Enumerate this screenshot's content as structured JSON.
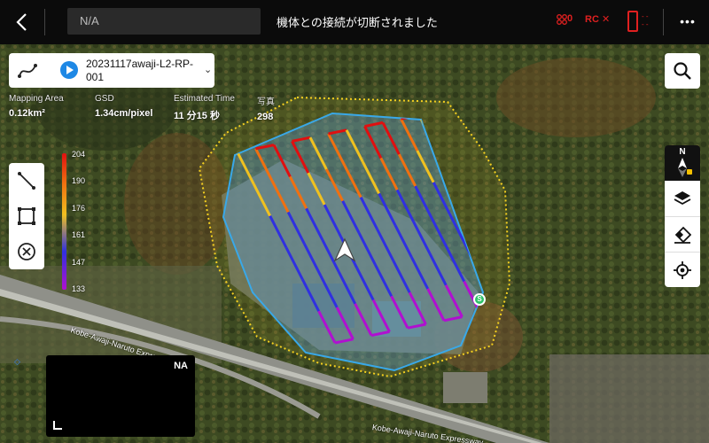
{
  "header": {
    "mission_title": "N/A",
    "connection_message": "機体との接続が切断されました",
    "drone_status": "0",
    "rc_status": "RC ✕",
    "battery_dashes": "- -\n- -",
    "more_menu": "•••"
  },
  "mission": {
    "name": "20231117awaji-L2-RP-001"
  },
  "stats": [
    {
      "label": "Mapping Area",
      "value": "0.12km²"
    },
    {
      "label": "GSD",
      "value": "1.34cm/pixel"
    },
    {
      "label": "Estimated Time",
      "value": "11 分15 秒"
    },
    {
      "label": "写真",
      "value": "298"
    }
  ],
  "altitude_legend": [
    "204",
    "190",
    "176",
    "161",
    "147",
    "133"
  ],
  "map": {
    "road_label": "Kobe-Awaji-Naruto Expressway",
    "road_label_2": "Kobe-Awaji-Naruto Expressway",
    "start_marker": "S"
  },
  "preview": {
    "status": "NA"
  },
  "compass": {
    "north_label": "N"
  },
  "colors": {
    "altitude_high": "#e01010",
    "altitude_mid_high": "#f07010",
    "altitude_mid": "#f0c020",
    "altitude_mid_low": "#3030e0",
    "altitude_low": "#b010d0",
    "area_outline": "#39a8e8",
    "buffer_outline": "#f5d020",
    "accent": "#1e88e5",
    "alert": "#e02020"
  },
  "icons": {
    "back": "chevron-left-icon",
    "drone": "drone-icon",
    "battery": "battery-icon",
    "search": "search-icon",
    "layers": "layers-icon",
    "eraser": "eraser-icon",
    "locate": "locate-icon",
    "line": "line-icon",
    "polygon": "polygon-icon",
    "clear": "clear-icon"
  }
}
